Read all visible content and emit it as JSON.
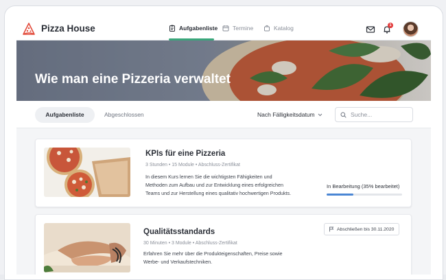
{
  "app": {
    "brand": "Pizza House"
  },
  "nav": {
    "tabs": [
      {
        "label": "Aufgabenliste",
        "icon": "clipboard-icon",
        "active": true
      },
      {
        "label": "Termine",
        "icon": "calendar-icon",
        "active": false
      },
      {
        "label": "Katalog",
        "icon": "bag-icon",
        "active": false
      }
    ],
    "notification_count": "1"
  },
  "hero": {
    "title": "Wie man eine Pizzeria verwaltet"
  },
  "filters": {
    "tabs": [
      "Aufgabenliste",
      "Abgeschlossen"
    ],
    "sort_label": "Nach Fälligkeitsdatum",
    "search_placeholder": "Suche..."
  },
  "courses": [
    {
      "title": "KPIs für eine Pizzeria",
      "meta": "3 Stunden • 15 Module • Abschluss-Zertifikat",
      "description": [
        "In diesem Kurs lernen Sie die wichtigsten Fähigkeiten und",
        "Methoden zum Aufbau und zur Entwicklung eines erfolgreichen",
        "Teams und zur Herstellung eines qualitativ hochwertigen Produkts."
      ],
      "progress_label": "In Bearbeitung (35% bearbeitet)",
      "progress_percent": 35
    },
    {
      "title": "Qualitätsstandards",
      "meta": "30 Minuten • 3 Module • Abschluss-Zertifikat",
      "description": [
        "Erfahren Sie mehr über die Produkteigenschaften, Preise sowie",
        "Werbe- und Verkaufstechniken."
      ],
      "due_label": "Abschließen bis 30.11.2020"
    }
  ],
  "colors": {
    "accent": "#3aa67b",
    "progress": "#4a86d4",
    "logo": "#e24b3b"
  }
}
